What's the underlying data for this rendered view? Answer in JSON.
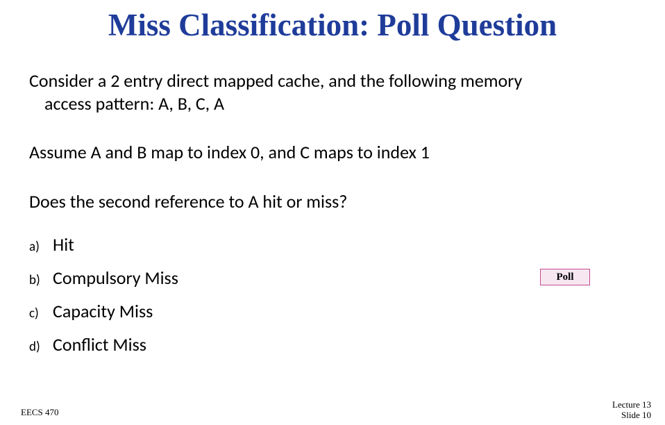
{
  "title": "Miss Classification: Poll Question",
  "para1_line1": "Consider a 2 entry direct mapped cache, and the following memory",
  "para1_line2": "access pattern: A, B, C, A",
  "para2": "Assume A and B map to index 0, and C maps to index 1",
  "para3": "Does the second reference to A hit or miss?",
  "options": {
    "a_marker": "a)",
    "a_text": "Hit",
    "b_marker": "b)",
    "b_text": "Compulsory Miss",
    "c_marker": "c)",
    "c_text": "Capacity Miss",
    "d_marker": "d)",
    "d_text": "Conflict Miss"
  },
  "poll_label": "Poll",
  "footer_left": "EECS 470",
  "footer_right_line1": "Lecture 13",
  "footer_right_line2": "Slide 10"
}
